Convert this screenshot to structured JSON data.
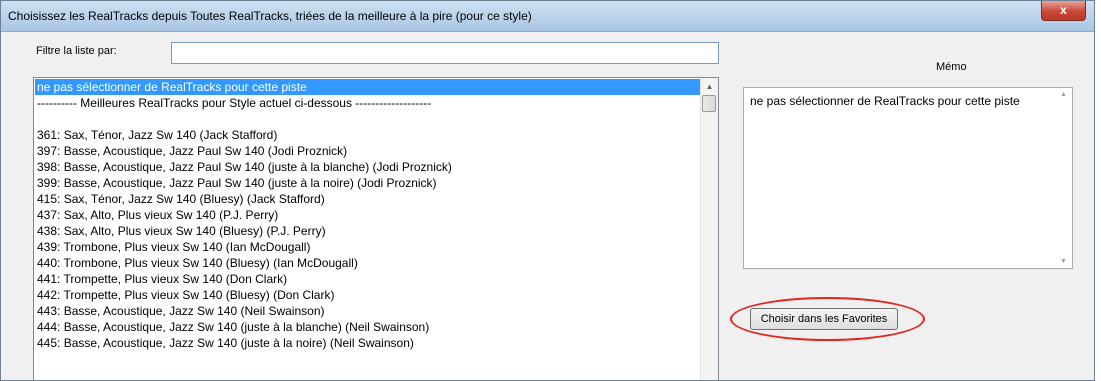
{
  "window": {
    "title": "Choisissez les RealTracks depuis Toutes RealTracks, triées de la meilleure à la pire (pour ce style)",
    "close_glyph": "x"
  },
  "filter": {
    "label": "Filtre la liste par:",
    "value": ""
  },
  "list": {
    "selected_index": 0,
    "items": [
      "ne pas sélectionner de RealTracks pour cette piste",
      "---------- Meilleures RealTracks pour Style actuel ci-dessous -------------------",
      "",
      "361: Sax, Ténor, Jazz Sw 140 (Jack Stafford)",
      "397: Basse, Acoustique, Jazz Paul Sw 140 (Jodi Proznick)",
      "398: Basse, Acoustique, Jazz Paul Sw 140  (juste à la blanche) (Jodi Proznick)",
      "399: Basse, Acoustique, Jazz Paul Sw 140  (juste à la noire) (Jodi Proznick)",
      "415: Sax, Ténor, Jazz Sw 140  (Bluesy) (Jack Stafford)",
      "437: Sax, Alto, Plus vieux Sw 140 (P.J. Perry)",
      "438: Sax, Alto, Plus vieux Sw 140  (Bluesy) (P.J. Perry)",
      "439: Trombone, Plus vieux Sw 140 (Ian McDougall)",
      "440: Trombone, Plus vieux Sw 140  (Bluesy) (Ian McDougall)",
      "441: Trompette, Plus vieux Sw 140 (Don Clark)",
      "442: Trompette, Plus vieux Sw 140  (Bluesy) (Don Clark)",
      "443: Basse, Acoustique, Jazz Sw 140 (Neil Swainson)",
      "444: Basse, Acoustique, Jazz Sw 140  (juste à la blanche) (Neil Swainson)",
      "445: Basse, Acoustique, Jazz Sw 140  (juste à la noire) (Neil Swainson)"
    ]
  },
  "memo": {
    "label": "Mémo",
    "text": "ne pas sélectionner de RealTracks pour cette piste"
  },
  "favorites_button": {
    "label": "Choisir dans les Favorites"
  },
  "icons": {
    "scroll_up": "▲",
    "scroll_down": "▼"
  }
}
